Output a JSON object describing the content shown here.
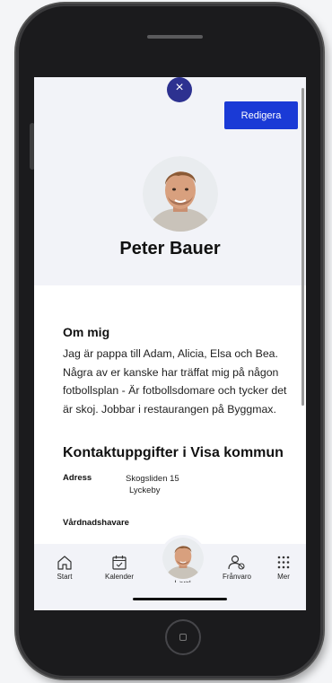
{
  "header": {
    "close_label": "×",
    "edit_label": "Redigera"
  },
  "profile": {
    "name": "Peter Bauer"
  },
  "about": {
    "title": "Om mig",
    "lines": [
      "Jag är pappa till Adam, Alicia, Elsa och Bea.",
      "Några av er kanske har träffat mig på någon",
      "fotbollsplan - Är fotbollsdomare och tycker det",
      "är skoj. Jobbar i restaurangen på Byggmax."
    ]
  },
  "contact": {
    "title": "Kontaktuppgifter i Visa kommun",
    "address_label": "Adress",
    "address_line1": "Skogsliden 15",
    "address_line2": "Lyckeby",
    "guardian_label": "Vårdnadshavare"
  },
  "tabbar": {
    "items": [
      {
        "label": "Start",
        "icon": "home-icon"
      },
      {
        "label": "Kalender",
        "icon": "calendar-icon"
      },
      {
        "label": "Peter",
        "icon": "avatar"
      },
      {
        "label": "Frånvaro",
        "icon": "absence-icon"
      },
      {
        "label": "Mer",
        "icon": "grid-icon"
      }
    ]
  },
  "colors": {
    "accent": "#1a3ad6",
    "close_bg": "#2d3190",
    "header_bg": "#f2f3f8"
  }
}
